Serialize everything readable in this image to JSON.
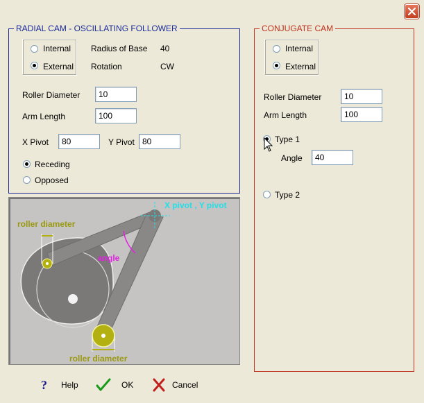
{
  "window": {
    "close_icon": "close-icon"
  },
  "radial_group": {
    "title": "RADIAL CAM - OSCILLATING FOLLOWER",
    "color": "#1a2a9c",
    "internal_label": "Internal",
    "external_label": "External",
    "radius_of_base_label": "Radius of Base",
    "radius_of_base_value": "40",
    "rotation_label": "Rotation",
    "rotation_value": "CW",
    "roller_diameter_label": "Roller Diameter",
    "roller_diameter_value": "10",
    "arm_length_label": "Arm Length",
    "arm_length_value": "100",
    "x_pivot_label": "X Pivot",
    "x_pivot_value": "80",
    "y_pivot_label": "Y Pivot",
    "y_pivot_value": "80",
    "receding_label": "Receding",
    "opposed_label": "Opposed"
  },
  "diagram": {
    "pivot_label": "X pivot , Y pivot",
    "roller_diameter_top": "roller diameter",
    "roller_diameter_bottom": "roller diameter",
    "angle_label": "angle",
    "colors": {
      "background": "#c6c3c3",
      "cam": "#7b7878",
      "arm": "#8a8787",
      "roller": "#b3b012",
      "label_olive": "#9a9a10",
      "label_magenta": "#e022e0",
      "label_cyan": "#22e0e8"
    }
  },
  "conjugate_group": {
    "title": "CONJUGATE CAM",
    "color": "#c0301c",
    "internal_label": "Internal",
    "external_label": "External",
    "roller_diameter_label": "Roller Diameter",
    "roller_diameter_value": "10",
    "arm_length_label": "Arm Length",
    "arm_length_value": "100",
    "type1_label": "Type 1",
    "angle_label": "Angle",
    "angle_value": "40",
    "type2_label": "Type 2"
  },
  "buttons": {
    "help_label": "Help",
    "ok_label": "OK",
    "cancel_label": "Cancel"
  }
}
